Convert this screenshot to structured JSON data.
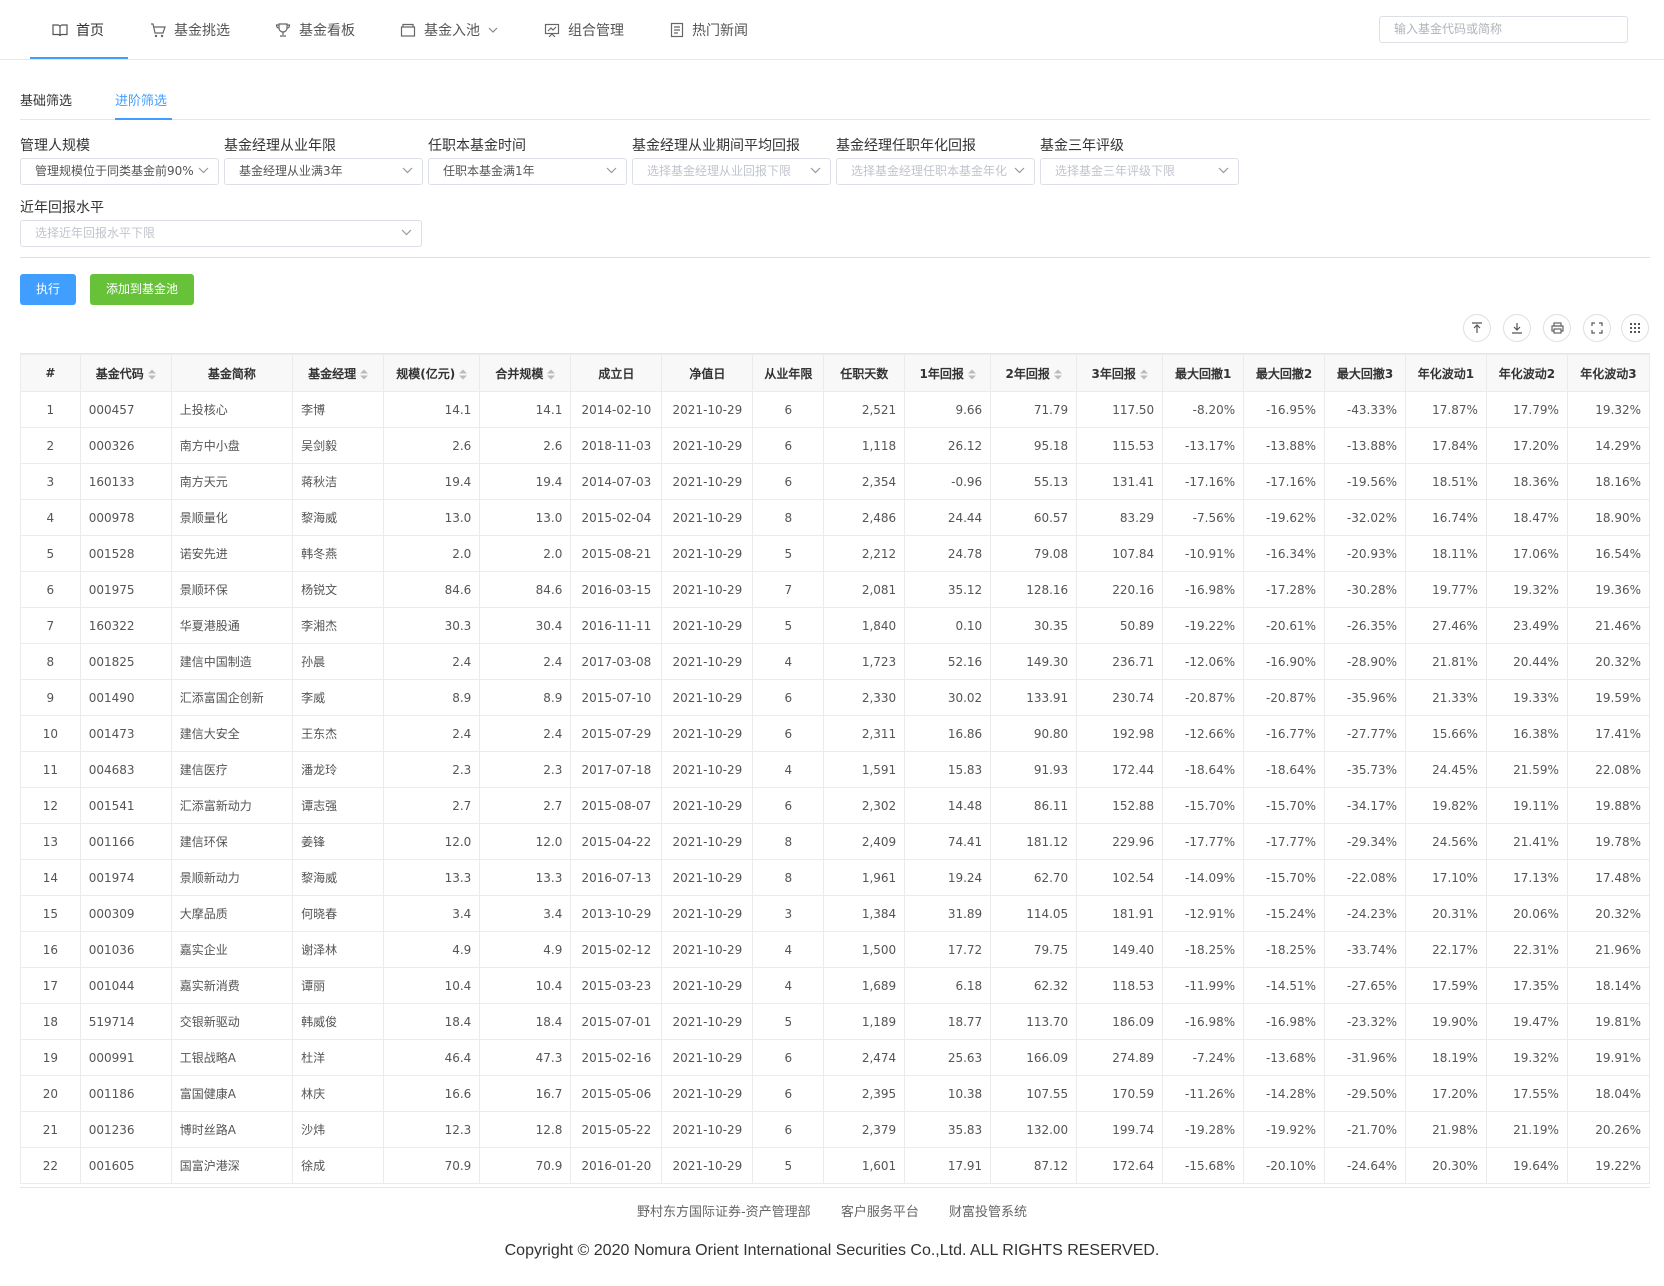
{
  "nav": {
    "items": [
      {
        "label": "首页"
      },
      {
        "label": "基金挑选"
      },
      {
        "label": "基金看板"
      },
      {
        "label": "基金入池"
      },
      {
        "label": "组合管理"
      },
      {
        "label": "热门新闻"
      }
    ],
    "search_placeholder": "输入基金代码或简称"
  },
  "tabs": {
    "basic": "基础筛选",
    "advanced": "进阶筛选"
  },
  "filters": {
    "manager_scale": {
      "label": "管理人规模",
      "value": "管理规模位于同类基金前90%"
    },
    "manager_years": {
      "label": "基金经理从业年限",
      "value": "基金经理从业满3年"
    },
    "tenure": {
      "label": "任职本基金时间",
      "value": "任职本基金满1年"
    },
    "avg_return": {
      "label": "基金经理从业期间平均回报",
      "placeholder": "选择基金经理从业回报下限"
    },
    "annual_return": {
      "label": "基金经理任职年化回报",
      "placeholder": "选择基金经理任职本基金年化"
    },
    "rating": {
      "label": "基金三年评级",
      "placeholder": "选择基金三年评级下限"
    },
    "recent_return": {
      "label": "近年回报水平",
      "placeholder": "选择近年回报水平下限"
    }
  },
  "buttons": {
    "run": "执行",
    "add_pool": "添加到基金池"
  },
  "table": {
    "headers": [
      "#",
      "基金代码",
      "基金简称",
      "基金经理",
      "规模(亿元)",
      "合并规模",
      "成立日",
      "净值日",
      "从业年限",
      "任职天数",
      "1年回报",
      "2年回报",
      "3年回报",
      "最大回撤1",
      "最大回撤2",
      "最大回撤3",
      "年化波动1",
      "年化波动2",
      "年化波动3"
    ],
    "rows": [
      [
        "1",
        "000457",
        "上投核心",
        "李博",
        "14.1",
        "14.1",
        "2014-02-10",
        "2021-10-29",
        "6",
        "2,521",
        "9.66",
        "71.79",
        "117.50",
        "-8.20%",
        "-16.95%",
        "-43.33%",
        "17.87%",
        "17.79%",
        "19.32%"
      ],
      [
        "2",
        "000326",
        "南方中小盘",
        "吴剑毅",
        "2.6",
        "2.6",
        "2018-11-03",
        "2021-10-29",
        "6",
        "1,118",
        "26.12",
        "95.18",
        "115.53",
        "-13.17%",
        "-13.88%",
        "-13.88%",
        "17.84%",
        "17.20%",
        "14.29%"
      ],
      [
        "3",
        "160133",
        "南方天元",
        "蒋秋洁",
        "19.4",
        "19.4",
        "2014-07-03",
        "2021-10-29",
        "6",
        "2,354",
        "-0.96",
        "55.13",
        "131.41",
        "-17.16%",
        "-17.16%",
        "-19.56%",
        "18.51%",
        "18.36%",
        "18.16%"
      ],
      [
        "4",
        "000978",
        "景顺量化",
        "黎海威",
        "13.0",
        "13.0",
        "2015-02-04",
        "2021-10-29",
        "8",
        "2,486",
        "24.44",
        "60.57",
        "83.29",
        "-7.56%",
        "-19.62%",
        "-32.02%",
        "16.74%",
        "18.47%",
        "18.90%"
      ],
      [
        "5",
        "001528",
        "诺安先进",
        "韩冬燕",
        "2.0",
        "2.0",
        "2015-08-21",
        "2021-10-29",
        "5",
        "2,212",
        "24.78",
        "79.08",
        "107.84",
        "-10.91%",
        "-16.34%",
        "-20.93%",
        "18.11%",
        "17.06%",
        "16.54%"
      ],
      [
        "6",
        "001975",
        "景顺环保",
        "杨锐文",
        "84.6",
        "84.6",
        "2016-03-15",
        "2021-10-29",
        "7",
        "2,081",
        "35.12",
        "128.16",
        "220.16",
        "-16.98%",
        "-17.28%",
        "-30.28%",
        "19.77%",
        "19.32%",
        "19.36%"
      ],
      [
        "7",
        "160322",
        "华夏港股通",
        "李湘杰",
        "30.3",
        "30.4",
        "2016-11-11",
        "2021-10-29",
        "5",
        "1,840",
        "0.10",
        "30.35",
        "50.89",
        "-19.22%",
        "-20.61%",
        "-26.35%",
        "27.46%",
        "23.49%",
        "21.46%"
      ],
      [
        "8",
        "001825",
        "建信中国制造",
        "孙晨",
        "2.4",
        "2.4",
        "2017-03-08",
        "2021-10-29",
        "4",
        "1,723",
        "52.16",
        "149.30",
        "236.71",
        "-12.06%",
        "-16.90%",
        "-28.90%",
        "21.81%",
        "20.44%",
        "20.32%"
      ],
      [
        "9",
        "001490",
        "汇添富国企创新",
        "李威",
        "8.9",
        "8.9",
        "2015-07-10",
        "2021-10-29",
        "6",
        "2,330",
        "30.02",
        "133.91",
        "230.74",
        "-20.87%",
        "-20.87%",
        "-35.96%",
        "21.33%",
        "19.33%",
        "19.59%"
      ],
      [
        "10",
        "001473",
        "建信大安全",
        "王东杰",
        "2.4",
        "2.4",
        "2015-07-29",
        "2021-10-29",
        "6",
        "2,311",
        "16.86",
        "90.80",
        "192.98",
        "-12.66%",
        "-16.77%",
        "-27.77%",
        "15.66%",
        "16.38%",
        "17.41%"
      ],
      [
        "11",
        "004683",
        "建信医疗",
        "潘龙玲",
        "2.3",
        "2.3",
        "2017-07-18",
        "2021-10-29",
        "4",
        "1,591",
        "15.83",
        "91.93",
        "172.44",
        "-18.64%",
        "-18.64%",
        "-35.73%",
        "24.45%",
        "21.59%",
        "22.08%"
      ],
      [
        "12",
        "001541",
        "汇添富新动力",
        "谭志强",
        "2.7",
        "2.7",
        "2015-08-07",
        "2021-10-29",
        "6",
        "2,302",
        "14.48",
        "86.11",
        "152.88",
        "-15.70%",
        "-15.70%",
        "-34.17%",
        "19.82%",
        "19.11%",
        "19.88%"
      ],
      [
        "13",
        "001166",
        "建信环保",
        "姜锋",
        "12.0",
        "12.0",
        "2015-04-22",
        "2021-10-29",
        "8",
        "2,409",
        "74.41",
        "181.12",
        "229.96",
        "-17.77%",
        "-17.77%",
        "-29.34%",
        "24.56%",
        "21.41%",
        "19.78%"
      ],
      [
        "14",
        "001974",
        "景顺新动力",
        "黎海威",
        "13.3",
        "13.3",
        "2016-07-13",
        "2021-10-29",
        "8",
        "1,961",
        "19.24",
        "62.70",
        "102.54",
        "-14.09%",
        "-15.70%",
        "-22.08%",
        "17.10%",
        "17.13%",
        "17.48%"
      ],
      [
        "15",
        "000309",
        "大摩品质",
        "何晓春",
        "3.4",
        "3.4",
        "2013-10-29",
        "2021-10-29",
        "3",
        "1,384",
        "31.89",
        "114.05",
        "181.91",
        "-12.91%",
        "-15.24%",
        "-24.23%",
        "20.31%",
        "20.06%",
        "20.32%"
      ],
      [
        "16",
        "001036",
        "嘉实企业",
        "谢泽林",
        "4.9",
        "4.9",
        "2015-02-12",
        "2021-10-29",
        "4",
        "1,500",
        "17.72",
        "79.75",
        "149.40",
        "-18.25%",
        "-18.25%",
        "-33.74%",
        "22.17%",
        "22.31%",
        "21.96%"
      ],
      [
        "17",
        "001044",
        "嘉实新消费",
        "谭丽",
        "10.4",
        "10.4",
        "2015-03-23",
        "2021-10-29",
        "4",
        "1,689",
        "6.18",
        "62.32",
        "118.53",
        "-11.99%",
        "-14.51%",
        "-27.65%",
        "17.59%",
        "17.35%",
        "18.14%"
      ],
      [
        "18",
        "519714",
        "交银新驱动",
        "韩威俊",
        "18.4",
        "18.4",
        "2015-07-01",
        "2021-10-29",
        "5",
        "1,189",
        "18.77",
        "113.70",
        "186.09",
        "-16.98%",
        "-16.98%",
        "-23.32%",
        "19.90%",
        "19.47%",
        "19.81%"
      ],
      [
        "19",
        "000991",
        "工银战略A",
        "杜洋",
        "46.4",
        "47.3",
        "2015-02-16",
        "2021-10-29",
        "6",
        "2,474",
        "25.63",
        "166.09",
        "274.89",
        "-7.24%",
        "-13.68%",
        "-31.96%",
        "18.19%",
        "19.32%",
        "19.91%"
      ],
      [
        "20",
        "001186",
        "富国健康A",
        "林庆",
        "16.6",
        "16.7",
        "2015-05-06",
        "2021-10-29",
        "6",
        "2,395",
        "10.38",
        "107.55",
        "170.59",
        "-11.26%",
        "-14.28%",
        "-29.50%",
        "17.20%",
        "17.55%",
        "18.04%"
      ],
      [
        "21",
        "001236",
        "博时丝路A",
        "沙炜",
        "12.3",
        "12.8",
        "2015-05-22",
        "2021-10-29",
        "6",
        "2,379",
        "35.83",
        "132.00",
        "199.74",
        "-19.28%",
        "-19.92%",
        "-21.70%",
        "21.98%",
        "21.19%",
        "20.26%"
      ],
      [
        "22",
        "001605",
        "国富沪港深",
        "徐成",
        "70.9",
        "70.9",
        "2016-01-20",
        "2021-10-29",
        "5",
        "1,601",
        "17.91",
        "87.12",
        "172.64",
        "-15.68%",
        "-20.10%",
        "-24.64%",
        "20.30%",
        "19.64%",
        "19.22%"
      ]
    ]
  },
  "footer": {
    "links": [
      "野村东方国际证券-资产管理部",
      "客户服务平台",
      "财富投管系统"
    ],
    "copyright": "Copyright © 2020 Nomura Orient International Securities Co.,Ltd. ALL RIGHTS RESERVED."
  }
}
